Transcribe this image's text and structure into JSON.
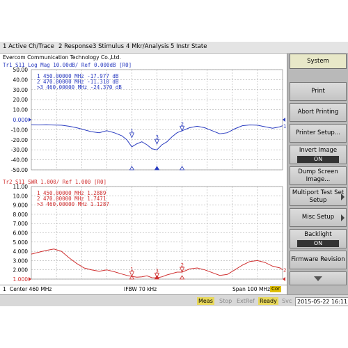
{
  "menubar": {
    "items": [
      "1 Active Ch/Trace",
      "2 Response",
      "3 Stimulus",
      "4 Mkr/Analysis",
      "5 Instr State"
    ]
  },
  "titlebar": {
    "text": "Evercom Communication Technology Co.,Ltd."
  },
  "softkeys": {
    "title": "System",
    "items": [
      {
        "label": "Print"
      },
      {
        "label": "Abort Printing"
      },
      {
        "label": "Printer Setup..."
      },
      {
        "label": "Invert Image",
        "state": "ON"
      },
      {
        "label": "Dump Screen Image..."
      },
      {
        "label": "Multiport Test Set Setup"
      },
      {
        "label": "Misc Setup"
      },
      {
        "label": "Backlight",
        "state": "ON"
      },
      {
        "label": "Firmware Revision"
      }
    ]
  },
  "chart_data": [
    {
      "type": "line",
      "trace": "Tr1",
      "header": "Tr1 S11 Log Mag 10.00dB/ Ref 0.000dB [R0]",
      "color": "#2a3cc0",
      "ylim": [
        -50,
        50
      ],
      "ref_value": 0,
      "ytick_labels": [
        "50.00",
        "40.00",
        "30.00",
        "20.00",
        "10.00",
        "0.000",
        "-10.00",
        "-20.00",
        "-30.00",
        "-40.00",
        "-50.00"
      ],
      "ytick_values": [
        50,
        40,
        30,
        20,
        10,
        0,
        -10,
        -20,
        -30,
        -40,
        -50
      ],
      "x": [
        410,
        413,
        416,
        419,
        422,
        425,
        428,
        431,
        434,
        437,
        440,
        443,
        446,
        448,
        450,
        452,
        454,
        456,
        458,
        460,
        462,
        464,
        466,
        468,
        470,
        473,
        476,
        479,
        482,
        485,
        488,
        491,
        494,
        497,
        500,
        503,
        506,
        509,
        510
      ],
      "y": [
        -5,
        -5.2,
        -5.0,
        -5.3,
        -5.5,
        -6.5,
        -8,
        -10,
        -12,
        -13,
        -11,
        -13,
        -16,
        -20,
        -27,
        -24,
        -22,
        -25,
        -29,
        -30,
        -25,
        -22,
        -17,
        -13,
        -11,
        -8,
        -6.5,
        -8,
        -11,
        -14,
        -13,
        -9,
        -6,
        -5.2,
        -5.5,
        -7,
        -8.5,
        -7,
        -6
      ],
      "markers": [
        {
          "label": "1",
          "x_mhz": "450.00000 MHz",
          "value": "-17.977 dB",
          "x": 450,
          "y": -17.977
        },
        {
          "label": "2",
          "x_mhz": "470.00000 MHz",
          "value": "-11.310 dB",
          "x": 470,
          "y": -11.31
        },
        {
          "label": ">3",
          "x_mhz": "460.00000 MHz",
          "value": "-24.370 dB",
          "x": 460,
          "y": -24.37,
          "active": true
        }
      ]
    },
    {
      "type": "line",
      "trace": "Tr2",
      "header": "Tr2 S11 SWR 1.000/ Ref 1.000 [R0]",
      "color": "#d03030",
      "ylim": [
        1,
        11
      ],
      "ref_value": 1,
      "ytick_labels": [
        "11.00",
        "10.00",
        "9.000",
        "8.000",
        "7.000",
        "6.000",
        "5.000",
        "4.000",
        "3.000",
        "2.000",
        "1.000"
      ],
      "ytick_values": [
        11,
        10,
        9,
        8,
        7,
        6,
        5,
        4,
        3,
        2,
        1
      ],
      "x": [
        410,
        413,
        416,
        419,
        422,
        425,
        428,
        431,
        434,
        437,
        440,
        443,
        446,
        448,
        450,
        452,
        454,
        456,
        458,
        460,
        462,
        464,
        466,
        468,
        470,
        473,
        476,
        479,
        482,
        485,
        488,
        491,
        494,
        497,
        500,
        503,
        506,
        509,
        510
      ],
      "y": [
        3.7,
        3.9,
        4.1,
        4.25,
        4.0,
        3.3,
        2.7,
        2.2,
        2.0,
        1.85,
        2.0,
        1.8,
        1.55,
        1.4,
        1.29,
        1.2,
        1.25,
        1.35,
        1.15,
        1.13,
        1.25,
        1.45,
        1.6,
        1.75,
        1.75,
        2.1,
        2.2,
        2.0,
        1.7,
        1.4,
        1.5,
        2.0,
        2.5,
        2.9,
        3.0,
        2.8,
        2.4,
        2.2,
        2.0
      ],
      "markers": [
        {
          "label": "1",
          "x_mhz": "450.00000 MHz",
          "value": "1.2889",
          "x": 450,
          "y": 1.2889
        },
        {
          "label": "2",
          "x_mhz": "470.00000 MHz",
          "value": "1.7471",
          "x": 470,
          "y": 1.7471
        },
        {
          "label": ">3",
          "x_mhz": "460.00000 MHz",
          "value": "1.1287",
          "x": 460,
          "y": 1.1287,
          "active": true
        }
      ]
    }
  ],
  "channel_bar": {
    "channel": "1",
    "start": "Center 460 MHz",
    "ifbw": "IFBW 70 kHz",
    "span": "Span 100 MHz",
    "cor": "Cor"
  },
  "statusbar": {
    "meas": "Meas",
    "stop": "Stop",
    "extref": "ExtRef",
    "ready": "Ready",
    "svc": "Svc",
    "datetime": "2015-05-22 16:11"
  }
}
